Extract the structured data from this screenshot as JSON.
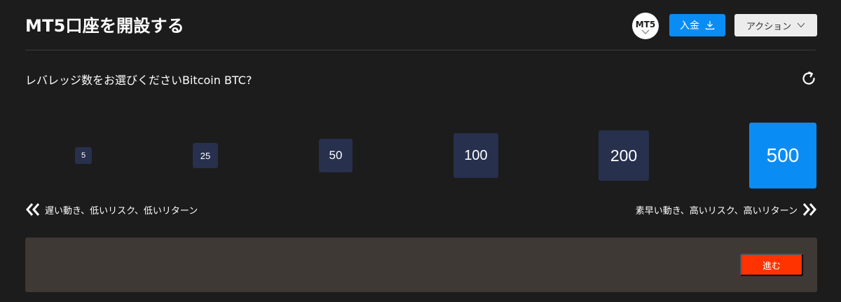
{
  "header": {
    "title": "MT5口座を開設する",
    "platform_badge": "MT5",
    "deposit_label": "入金",
    "actions_label": "アクション"
  },
  "question": "レバレッジ数をお選びくださいBitcoin BTC?",
  "leverage": {
    "options": [
      "5",
      "25",
      "50",
      "100",
      "200",
      "500"
    ],
    "selected": "500"
  },
  "range": {
    "low_label": "遅い動き、低いリスク、低いリターン",
    "high_label": "素早い動き、高いリスク、高いリターン"
  },
  "footer": {
    "proceed_label": "進む"
  },
  "icons": {
    "deposit": "download-icon",
    "actions": "chevron-down-icon",
    "refresh": "refresh-icon",
    "left": "double-chevron-left-icon",
    "right": "double-chevron-right-icon"
  },
  "colors": {
    "background": "#1c1c1c",
    "tile": "#27304d",
    "selected": "#0a8cf5",
    "primary_button": "#0a8cf5",
    "proceed_button": "#ff3300",
    "panel": "#3e3935"
  }
}
